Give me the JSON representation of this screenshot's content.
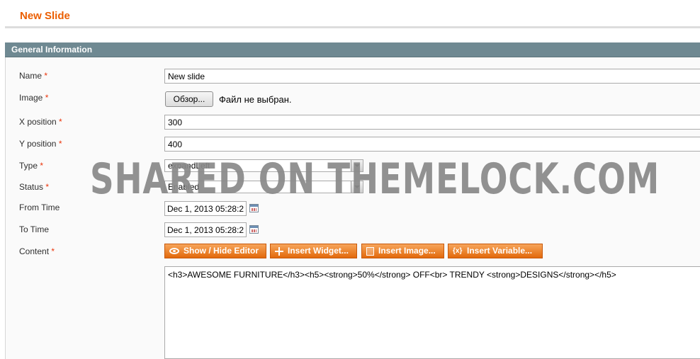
{
  "page": {
    "title": "New Slide"
  },
  "section": {
    "title": "General Information"
  },
  "form": {
    "name": {
      "label": "Name",
      "required": "*",
      "value": "New slide"
    },
    "image": {
      "label": "Image",
      "required": "*",
      "button": "Обзор...",
      "status": "Файл не выбран."
    },
    "x_position": {
      "label": "X position",
      "required": "*",
      "value": "300"
    },
    "y_position": {
      "label": "Y position",
      "required": "*",
      "value": "400"
    },
    "type": {
      "label": "Type",
      "required": "*",
      "value": "expandLeft"
    },
    "status": {
      "label": "Status",
      "required": "*",
      "value": "Enabled"
    },
    "from_time": {
      "label": "From Time",
      "value": "Dec 1, 2013 05:28:2"
    },
    "to_time": {
      "label": "To Time",
      "value": "Dec 1, 2013 05:28:2"
    },
    "content": {
      "label": "Content",
      "required": "*",
      "buttons": {
        "show_hide": "Show / Hide Editor",
        "insert_widget": "Insert Widget...",
        "insert_image": "Insert Image...",
        "insert_variable": "Insert Variable..."
      },
      "value": "<h3>AWESOME FURNITURE</h3><h5><strong>50%</strong> OFF<br> TRENDY <strong>DESIGNS</strong></h5>"
    }
  },
  "watermark": "SHARED ON THEMELOCK.COM",
  "colors": {
    "title": "#eb5e00",
    "section_header": "#6f8992",
    "button": "#e77a22",
    "required": "#eb340a"
  },
  "icons": [
    "calendar-icon",
    "eye-icon",
    "widget-icon",
    "image-icon",
    "variable-icon",
    "chevron-down-icon"
  ]
}
